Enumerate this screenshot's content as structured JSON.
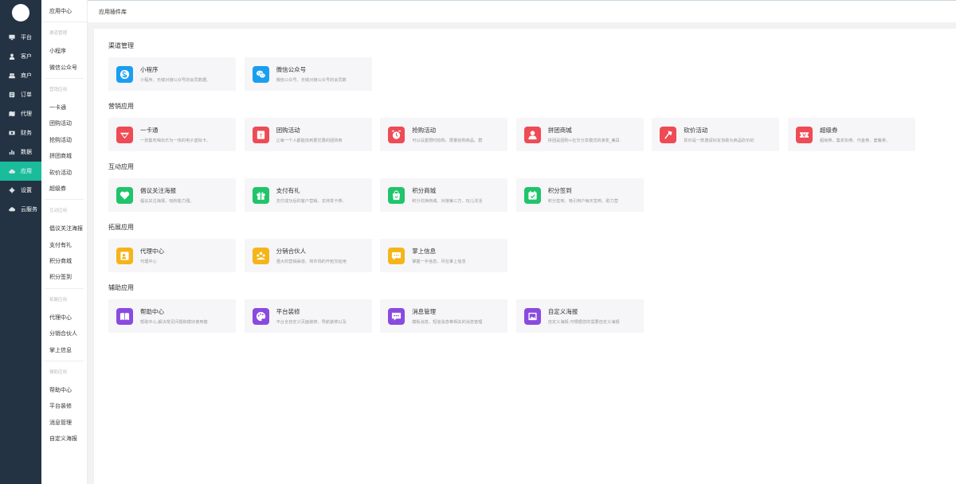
{
  "nav": {
    "items": [
      {
        "label": "平台",
        "icon": "monitor-icon"
      },
      {
        "label": "客户",
        "icon": "user-icon"
      },
      {
        "label": "商户",
        "icon": "users-icon"
      },
      {
        "label": "订单",
        "icon": "list-icon"
      },
      {
        "label": "代理",
        "icon": "map-icon"
      },
      {
        "label": "财务",
        "icon": "money-icon"
      },
      {
        "label": "数据",
        "icon": "bar-chart-icon"
      },
      {
        "label": "应用",
        "icon": "cloud-apps-icon"
      },
      {
        "label": "设置",
        "icon": "gear-icon"
      },
      {
        "label": "云服务",
        "icon": "cloud-icon"
      }
    ],
    "active_color": "#1abc9c"
  },
  "sidebar": {
    "title": "应用中心",
    "groups": [
      {
        "title": "渠道管理",
        "items": [
          "小程序",
          "微信公众号"
        ]
      },
      {
        "title": "营销应用",
        "items": [
          "一卡通",
          "团购活动",
          "抢购活动",
          "拼团商城",
          "砍价活动",
          "超级券"
        ]
      },
      {
        "title": "互动应用",
        "items": [
          "倡议关注海报",
          "支付有礼",
          "积分商城",
          "积分签到"
        ]
      },
      {
        "title": "拓展应用",
        "items": [
          "代理中心",
          "分销合伙人",
          "掌上信息"
        ]
      },
      {
        "title": "辅助应用",
        "items": [
          "帮助中心",
          "平台装修",
          "消息管理",
          "自定义海报"
        ]
      }
    ]
  },
  "topbar": {
    "title": "应用插件库"
  },
  "sections": [
    {
      "title": "渠道管理",
      "cards": [
        {
          "name": "小程序",
          "desc": "小程序、无缝对接公众号的会员数据、",
          "icon": "mini-program-icon",
          "color": "#1a9ff0"
        },
        {
          "name": "微信公众号",
          "desc": "微信公众号、无缝对接公众号的会员数",
          "icon": "wechat-icon",
          "color": "#1a9ff0"
        }
      ]
    },
    {
      "title": "营销应用",
      "cards": [
        {
          "name": "一卡通",
          "desc": "一张集吃喝玩乐为一体的电子虚拟卡、",
          "icon": "diamond-card-icon",
          "color": "#ee4b55"
        },
        {
          "name": "团购活动",
          "desc": "让每一个人都能找到更优惠的团购商",
          "icon": "group-buy-icon",
          "color": "#ee4b55"
        },
        {
          "name": "抢购活动",
          "desc": "可以设置限时抢购、限量抢购商品、群",
          "icon": "alarm-clock-icon",
          "color": "#ee4b55"
        },
        {
          "name": "拼团商城",
          "desc": "拼团是团购+社交分享模式的演变_兼具",
          "icon": "group-person-icon",
          "color": "#ee4b55"
        },
        {
          "name": "砍价活动",
          "desc": "砍价是一款邀请好友协助为商品砍价的",
          "icon": "axe-icon",
          "color": "#ee4b55"
        },
        {
          "name": "超级券",
          "desc": "超级券、集折扣券、代金券、套餐券、",
          "icon": "ticket-icon",
          "color": "#ee4b55"
        }
      ]
    },
    {
      "title": "互动应用",
      "cards": [
        {
          "name": "倡议关注海报",
          "desc": "倡议关注海报、吸粉能力强。",
          "icon": "heart-icon",
          "color": "#1fc46b"
        },
        {
          "name": "支付有礼",
          "desc": "支付成功后的客户营销、支持发卡券、",
          "icon": "gift-icon",
          "color": "#1fc46b"
        },
        {
          "name": "积分商城",
          "desc": "积分兑换商城、对接第三方、玩儿法活",
          "icon": "shopping-bag-icon",
          "color": "#1fc46b"
        },
        {
          "name": "积分签到",
          "desc": "积分签到、吸引用户每天签到、助力营",
          "icon": "calendar-check-icon",
          "color": "#1fc46b"
        }
      ]
    },
    {
      "title": "拓展应用",
      "cards": [
        {
          "name": "代理中心",
          "desc": "代理中心",
          "icon": "agent-icon",
          "color": "#f5b419"
        },
        {
          "name": "分销合伙人",
          "desc": "强大的营销渠道、将市场的开拓交给用",
          "icon": "partners-icon",
          "color": "#f5b419"
        },
        {
          "name": "掌上信息",
          "desc": "掌握一手信息、尽在掌上信息",
          "icon": "chat-bubble-icon",
          "color": "#f5b419"
        }
      ]
    },
    {
      "title": "辅助应用",
      "cards": [
        {
          "name": "帮助中心",
          "desc": "帮助中心,解决常见问题和模块使用篇",
          "icon": "book-icon",
          "color": "#8a4ae0"
        },
        {
          "name": "平台装修",
          "desc": "平台全自定义页面装修、导航装修以及",
          "icon": "palette-icon",
          "color": "#8a4ae0"
        },
        {
          "name": "消息管理",
          "desc": "模板消息、短信消息等相关的消息管理",
          "icon": "message-icon",
          "color": "#8a4ae0"
        },
        {
          "name": "自定义海报",
          "desc": "自定义海报,可根据您的需要自定义海报",
          "icon": "image-frame-icon",
          "color": "#8a4ae0"
        }
      ]
    }
  ]
}
